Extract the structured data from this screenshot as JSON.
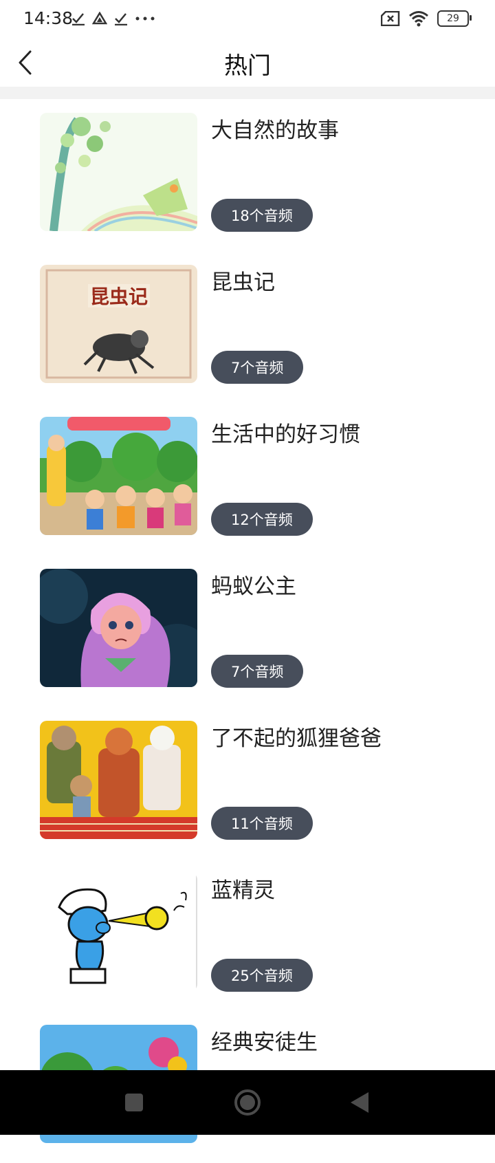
{
  "status_bar": {
    "time": "14:38",
    "battery": "29",
    "icons": [
      "check-icon",
      "drive-icon",
      "check-icon",
      "more-dots-icon",
      "sim-x-icon",
      "wifi-icon",
      "battery-icon"
    ]
  },
  "header": {
    "title": "热门",
    "back_icon": "chevron-left-icon"
  },
  "items": [
    {
      "title": "大自然的故事",
      "count": "18个音频",
      "thumb": "nature-cover"
    },
    {
      "title": "昆虫记",
      "count": "7个音频",
      "thumb": "insect-book-cover"
    },
    {
      "title": "生活中的好习惯",
      "count": "12个音频",
      "thumb": "good-habits-cover"
    },
    {
      "title": "蚂蚁公主",
      "count": "7个音频",
      "thumb": "ant-princess-cover"
    },
    {
      "title": "了不起的狐狸爸爸",
      "count": "11个音频",
      "thumb": "fox-dad-cover"
    },
    {
      "title": "蓝精灵",
      "count": "25个音频",
      "thumb": "smurf-cover"
    },
    {
      "title": "经典安徒生",
      "count": "",
      "thumb": "andersen-cover"
    }
  ],
  "nav": {
    "buttons": [
      "recent-apps-icon",
      "home-icon",
      "back-triangle-icon"
    ]
  },
  "colors": {
    "badge": "#474e5b",
    "separator": "#f2f2f2",
    "nav_bar": "#000000"
  }
}
